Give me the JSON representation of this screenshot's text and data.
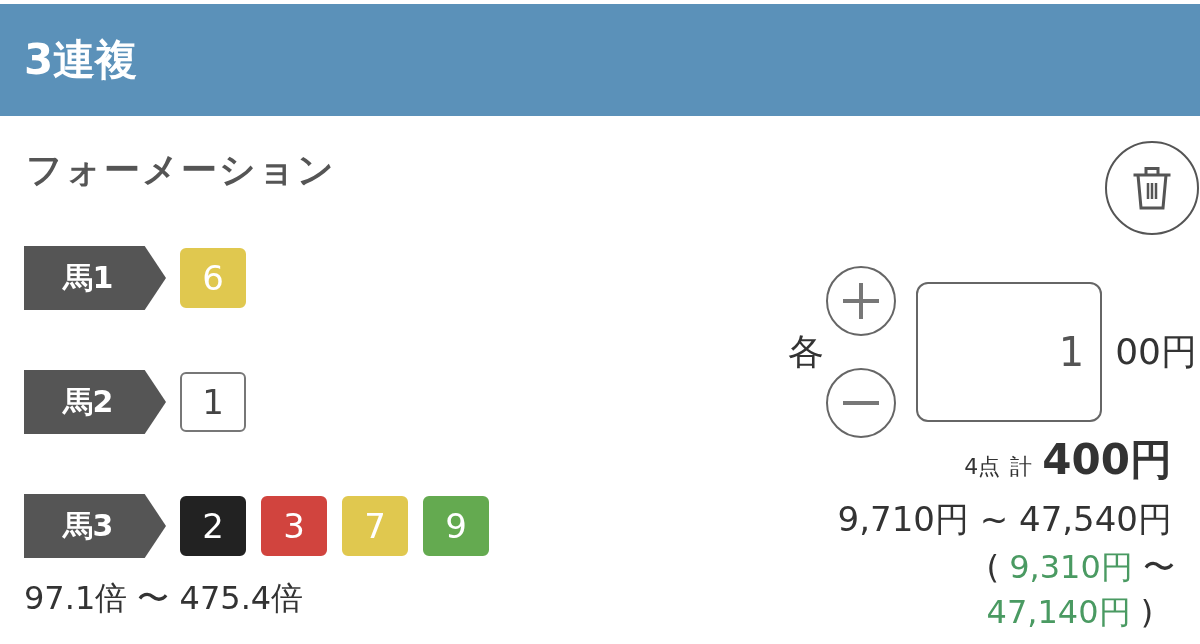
{
  "header": {
    "title": "3連複"
  },
  "bet_type": "フォーメーション",
  "legs": [
    {
      "label": "馬1",
      "horses": [
        {
          "number": "6",
          "color": "#e0c84f"
        }
      ]
    },
    {
      "label": "馬2",
      "horses": [
        {
          "number": "1",
          "color": "#ffffff"
        }
      ]
    },
    {
      "label": "馬3",
      "horses": [
        {
          "number": "2",
          "color": "#222222"
        },
        {
          "number": "3",
          "color": "#d1443e"
        },
        {
          "number": "7",
          "color": "#e0c84f"
        },
        {
          "number": "9",
          "color": "#64aa50"
        }
      ]
    }
  ],
  "odds_range": "97.1倍 〜 475.4倍",
  "stake": {
    "prefix": "各",
    "value": "1",
    "unit": "00円"
  },
  "summary": {
    "count": "4点",
    "total_label": "計",
    "total": "400円"
  },
  "payout_range": "9,710円 ~ 47,540円",
  "net_payout_range": {
    "open": "(",
    "low": "9,310円",
    "separator": "〜",
    "high": "47,140円",
    "close": ")"
  }
}
